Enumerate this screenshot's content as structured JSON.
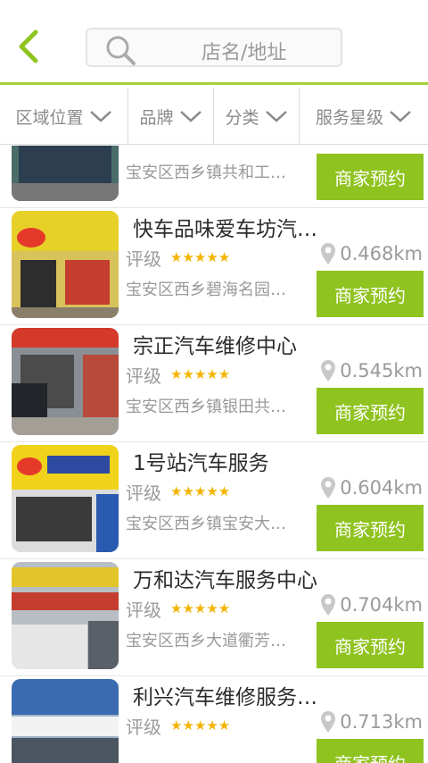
{
  "header": {
    "search_placeholder": "店名/地址"
  },
  "filters": [
    {
      "label": "区域位置"
    },
    {
      "label": "品牌"
    },
    {
      "label": "分类"
    },
    {
      "label": "服务星级"
    }
  ],
  "colors": {
    "accent": "#8fc31f",
    "star": "#f3b400",
    "text_muted": "#9a9a9a"
  },
  "shops": [
    {
      "name": "",
      "rating_label": "",
      "distance": "",
      "address": "宝安区西乡镇共和工…",
      "button": "商家预约"
    },
    {
      "name": "快车品味爱车坊汽…",
      "rating_label": "评级",
      "stars": 5,
      "distance": "0.468km",
      "address": "宝安区西乡碧海名园…",
      "button": "商家预约"
    },
    {
      "name": "宗正汽车维修中心",
      "rating_label": "评级",
      "stars": 5,
      "distance": "0.545km",
      "address": "宝安区西乡镇银田共…",
      "button": "商家预约"
    },
    {
      "name": "1号站汽车服务",
      "rating_label": "评级",
      "stars": 5,
      "distance": "0.604km",
      "address": "宝安区西乡镇宝安大…",
      "button": "商家预约"
    },
    {
      "name": "万和达汽车服务中心",
      "rating_label": "评级",
      "stars": 5,
      "distance": "0.704km",
      "address": "宝安区西乡大道衢芳…",
      "button": "商家预约"
    },
    {
      "name": "利兴汽车维修服务…",
      "rating_label": "评级",
      "stars": 5,
      "distance": "0.713km",
      "address": "",
      "button": "商家预约"
    }
  ]
}
